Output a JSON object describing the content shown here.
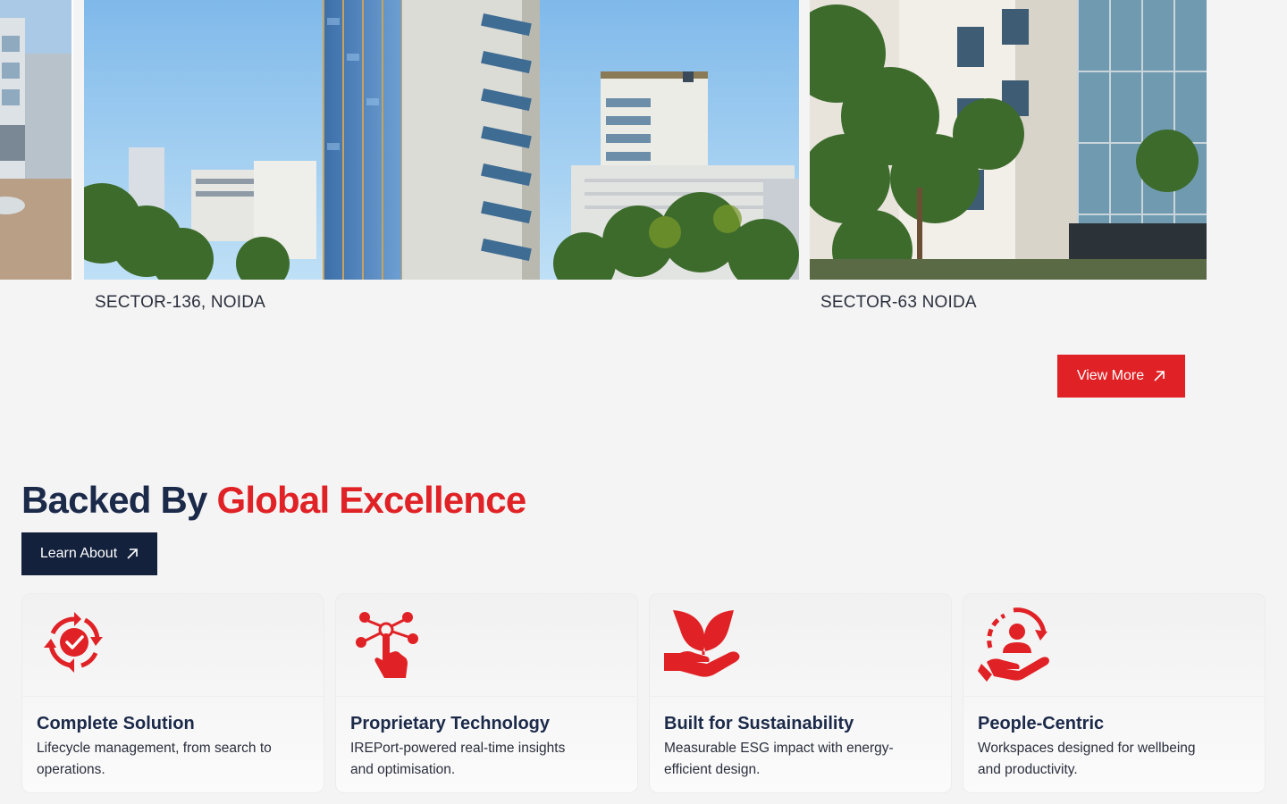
{
  "properties": [
    {
      "location": ""
    },
    {
      "location": "SECTOR-136, NOIDA"
    },
    {
      "location": "SECTOR-63 NOIDA"
    }
  ],
  "view_more_label": "View More",
  "section": {
    "title_part1": "Backed By",
    "title_part2": "Global Excellence",
    "learn_label": "Learn About"
  },
  "cards": [
    {
      "icon": "cycle-check-icon",
      "title": "Complete Solution",
      "desc": "Lifecycle management, from search to operations."
    },
    {
      "icon": "touch-network-icon",
      "title": "Proprietary Technology",
      "desc": "IREPort-powered real-time insights and optimisation."
    },
    {
      "icon": "hand-leaf-icon",
      "title": "Built for Sustainability",
      "desc": "Measurable ESG impact with energy-efficient design."
    },
    {
      "icon": "people-care-icon",
      "title": "People-Centric",
      "desc": "Workspaces designed for wellbeing and productivity."
    }
  ],
  "colors": {
    "accent": "#e02226",
    "navy": "#14213d",
    "heading": "#1c2a4a",
    "background": "#f4f4f4"
  }
}
